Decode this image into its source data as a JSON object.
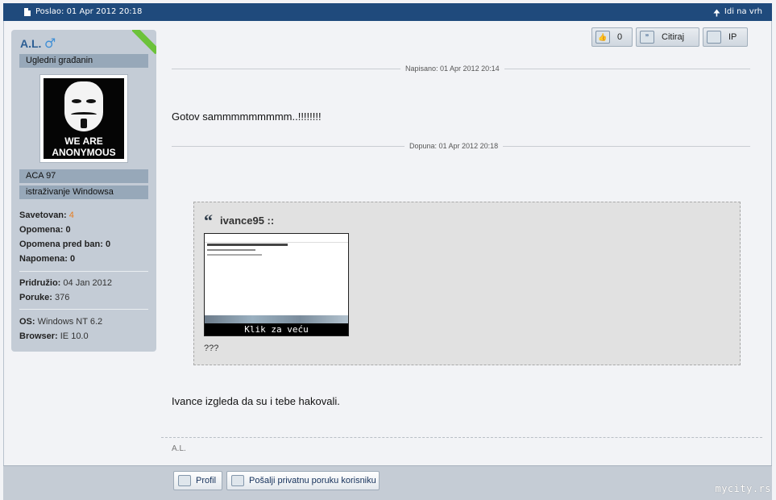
{
  "header": {
    "posted": "Poslao: 01 Apr 2012 20:18",
    "to_top": "Idi na vrh"
  },
  "author": {
    "name": "A.L.",
    "gender_symbol": "♂",
    "rank": "Ugledni građanin",
    "avatar_text_line1": "WE ARE",
    "avatar_text_line2": "ANONYMOUS",
    "tags": [
      "ACA 97",
      "istraživanje Windowsa"
    ],
    "stats": {
      "savetovan_label": "Savetovan:",
      "savetovan_value": "4",
      "opomena_label": "Opomena:",
      "opomena_value": "0",
      "opomena_ban_label": "Opomena pred ban:",
      "opomena_ban_value": "0",
      "napomena_label": "Napomena:",
      "napomena_value": "0",
      "pridruzio_label": "Pridružio:",
      "pridruzio_value": "04 Jan 2012",
      "poruke_label": "Poruke:",
      "poruke_value": "376",
      "os_label": "OS:",
      "os_value": "Windows NT 6.2",
      "browser_label": "Browser:",
      "browser_value": "IE 10.0"
    }
  },
  "actions": {
    "like_count": "0",
    "quote": "Citiraj",
    "ip": "IP"
  },
  "post": {
    "written": "Napisano: 01 Apr 2012 20:14",
    "message1": "Gotov sammmmmmmmm..!!!!!!!!",
    "edited": "Dopuna: 01 Apr 2012 20:18",
    "quote_author": "ivance95 ::",
    "thumb_caption": "Klik za veću",
    "quote_text": "???",
    "message2": "Ivance izgleda da su i tebe hakovali.",
    "signature": "A.L."
  },
  "footer": {
    "profile": "Profil",
    "private_message": "Pošalji privatnu poruku korisniku",
    "watermark": "mycity.rs"
  },
  "colors": {
    "header_bg": "#1f4a7c",
    "sidebar_bg": "#c4ccd6",
    "accent_green": "#6cc23a",
    "accent_orange": "#e77c1e"
  }
}
